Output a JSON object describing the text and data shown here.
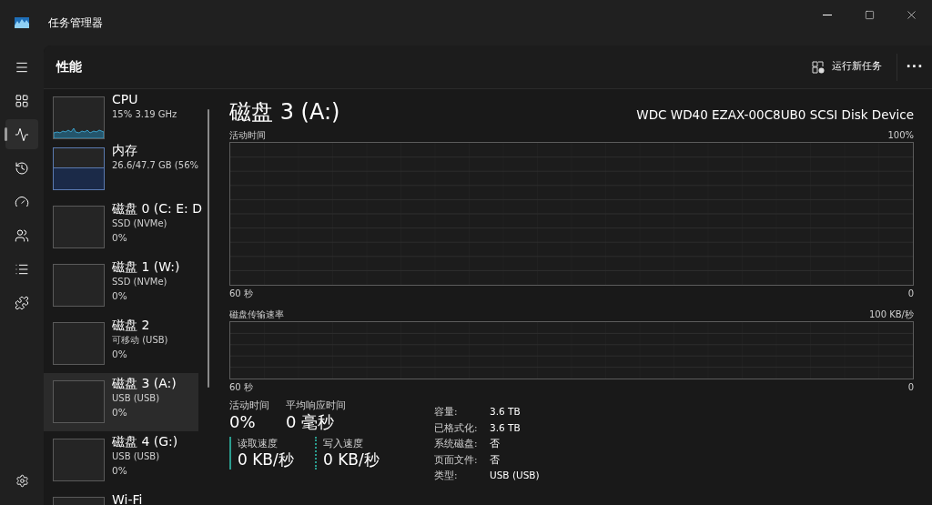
{
  "window": {
    "title": "任务管理器"
  },
  "nav": [
    {
      "kind": "menu",
      "selected": false
    },
    {
      "kind": "processes",
      "selected": false
    },
    {
      "kind": "performance",
      "selected": true
    },
    {
      "kind": "history",
      "selected": false
    },
    {
      "kind": "startup",
      "selected": false
    },
    {
      "kind": "users",
      "selected": false
    },
    {
      "kind": "details",
      "selected": false
    },
    {
      "kind": "services",
      "selected": false
    }
  ],
  "header": {
    "title": "性能",
    "run_task": "运行新任务",
    "more": "···"
  },
  "devices": [
    {
      "kind": "cpu",
      "name": "CPU",
      "line1": "15%  3.19 GHz",
      "selected": false
    },
    {
      "kind": "memory",
      "name": "内存",
      "line1": "26.6/47.7 GB (56%",
      "selected": false
    },
    {
      "kind": "disk",
      "name": "磁盘 0 (C: E: D",
      "line1": "SSD (NVMe)",
      "line2": "0%",
      "selected": false
    },
    {
      "kind": "disk",
      "name": "磁盘 1 (W:)",
      "line1": "SSD (NVMe)",
      "line2": "0%",
      "selected": false
    },
    {
      "kind": "disk",
      "name": "磁盘 2",
      "line1": "可移动 (USB)",
      "line2": "0%",
      "selected": false
    },
    {
      "kind": "disk",
      "name": "磁盘 3 (A:)",
      "line1": "USB (USB)",
      "line2": "0%",
      "selected": true
    },
    {
      "kind": "disk",
      "name": "磁盘 4 (G:)",
      "line1": "USB (USB)",
      "line2": "0%",
      "selected": false
    },
    {
      "kind": "disk",
      "name": "Wi-Fi",
      "selected": false
    }
  ],
  "detail": {
    "title": "磁盘 3 (A:)",
    "model": "WDC WD40 EZAX-00C8UB0 SCSI Disk Device",
    "charts": [
      {
        "kind": "activity",
        "label": "活动时间",
        "max": "100%",
        "time": "60 秒",
        "min": "0"
      },
      {
        "kind": "transfer",
        "label": "磁盘传输速率",
        "max": "100 KB/秒",
        "time": "60 秒",
        "min": "0"
      }
    ],
    "stats": [
      {
        "label": "活动时间",
        "value": "0%"
      },
      {
        "label": "平均响应时间",
        "value": "0 毫秒"
      }
    ],
    "speeds": [
      {
        "kind": "read",
        "label": "读取速度",
        "value": "0 KB/秒"
      },
      {
        "kind": "write",
        "label": "写入速度",
        "value": "0 KB/秒"
      }
    ],
    "props": [
      {
        "label": "容量:",
        "value": "3.6 TB"
      },
      {
        "label": "已格式化:",
        "value": "3.6 TB"
      },
      {
        "label": "系统磁盘:",
        "value": "否"
      },
      {
        "label": "页面文件:",
        "value": "否"
      },
      {
        "label": "类型:",
        "value": "USB (USB)"
      }
    ]
  }
}
